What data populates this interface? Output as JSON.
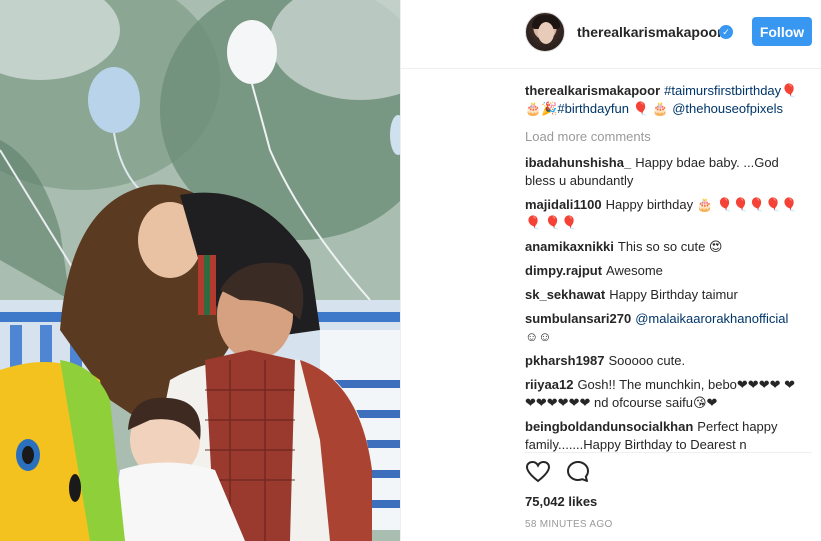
{
  "post": {
    "author": "therealkarismakapoor",
    "follow_label": "Follow",
    "caption": {
      "username": "therealkarismakapoor",
      "hashtag1": "#taimursfirstbirthday",
      "emojis": "🎈🎂🎉",
      "hashtag2": "#birthdayfun",
      "emoji2": "🎈 🎂",
      "mention": "@thehouseofpixels"
    },
    "load_more_label": "Load more comments",
    "comments": [
      {
        "user": "ibadahunshisha_",
        "text": "Happy bdae baby. ...God bless u abundantly"
      },
      {
        "user": "majidali1100",
        "text": "Happy birthday 🎂 🎈🎈🎈🎈🎈🎈 🎈🎈"
      },
      {
        "user": "anamikaxnikki",
        "text": "This so so cute 😍"
      },
      {
        "user": "dimpy.rajput",
        "text": "Awesome"
      },
      {
        "user": "sk_sekhawat",
        "text": "Happy Birthday taimur"
      },
      {
        "user": "sumbulansari270",
        "mention": "@malaikaarorakhanofficial",
        "text": "☺☺"
      },
      {
        "user": "pkharsh1987",
        "text": "Sooooo cute."
      },
      {
        "user": "riiyaa12",
        "text": "Gosh!! The munchkin, bebo❤❤❤❤ ❤❤❤❤❤❤❤ nd ofcourse saifu😘❤"
      },
      {
        "user": "beingboldandunsocialkhan",
        "text": "Perfect happy family.......Happy Birthday to Dearest n"
      }
    ],
    "likes": "75,042 likes",
    "timestamp": "58 MINUTES AGO"
  },
  "icons": {
    "like": "heart-icon",
    "comment": "comment-bubble-icon",
    "verified": "verified-badge-icon"
  },
  "colors": {
    "accent": "#3897f0",
    "link": "#003569",
    "muted": "#999999"
  }
}
